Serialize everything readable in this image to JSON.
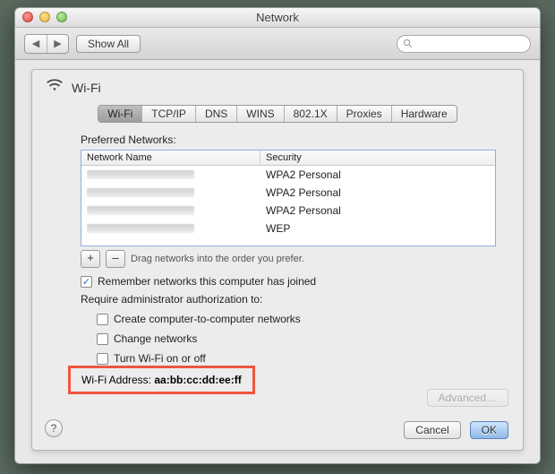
{
  "window": {
    "title": "Network"
  },
  "toolbar": {
    "show_all": "Show All",
    "search_placeholder": ""
  },
  "sheet": {
    "header_label": "Wi-Fi",
    "tabs": [
      "Wi-Fi",
      "TCP/IP",
      "DNS",
      "WINS",
      "802.1X",
      "Proxies",
      "Hardware"
    ],
    "active_tab_index": 0,
    "preferred_networks_label": "Preferred Networks:",
    "columns": {
      "name": "Network Name",
      "security": "Security"
    },
    "networks": [
      {
        "name": "",
        "security": "WPA2 Personal"
      },
      {
        "name": "",
        "security": "WPA2 Personal"
      },
      {
        "name": "",
        "security": "WPA2 Personal"
      },
      {
        "name": "",
        "security": "WEP"
      }
    ],
    "drag_hint": "Drag networks into the order you prefer.",
    "remember_label": "Remember networks this computer has joined",
    "remember_checked": true,
    "require_admin_label": "Require administrator authorization to:",
    "admin_options": [
      {
        "label": "Create computer-to-computer networks",
        "checked": false
      },
      {
        "label": "Change networks",
        "checked": false
      },
      {
        "label": "Turn Wi-Fi on or off",
        "checked": false
      }
    ],
    "wifi_address_label": "Wi-Fi Address:",
    "wifi_address_value": "aa:bb:cc:dd:ee:ff",
    "advanced_label": "Advanced…"
  },
  "buttons": {
    "cancel": "Cancel",
    "ok": "OK",
    "plus": "+",
    "minus": "–"
  }
}
